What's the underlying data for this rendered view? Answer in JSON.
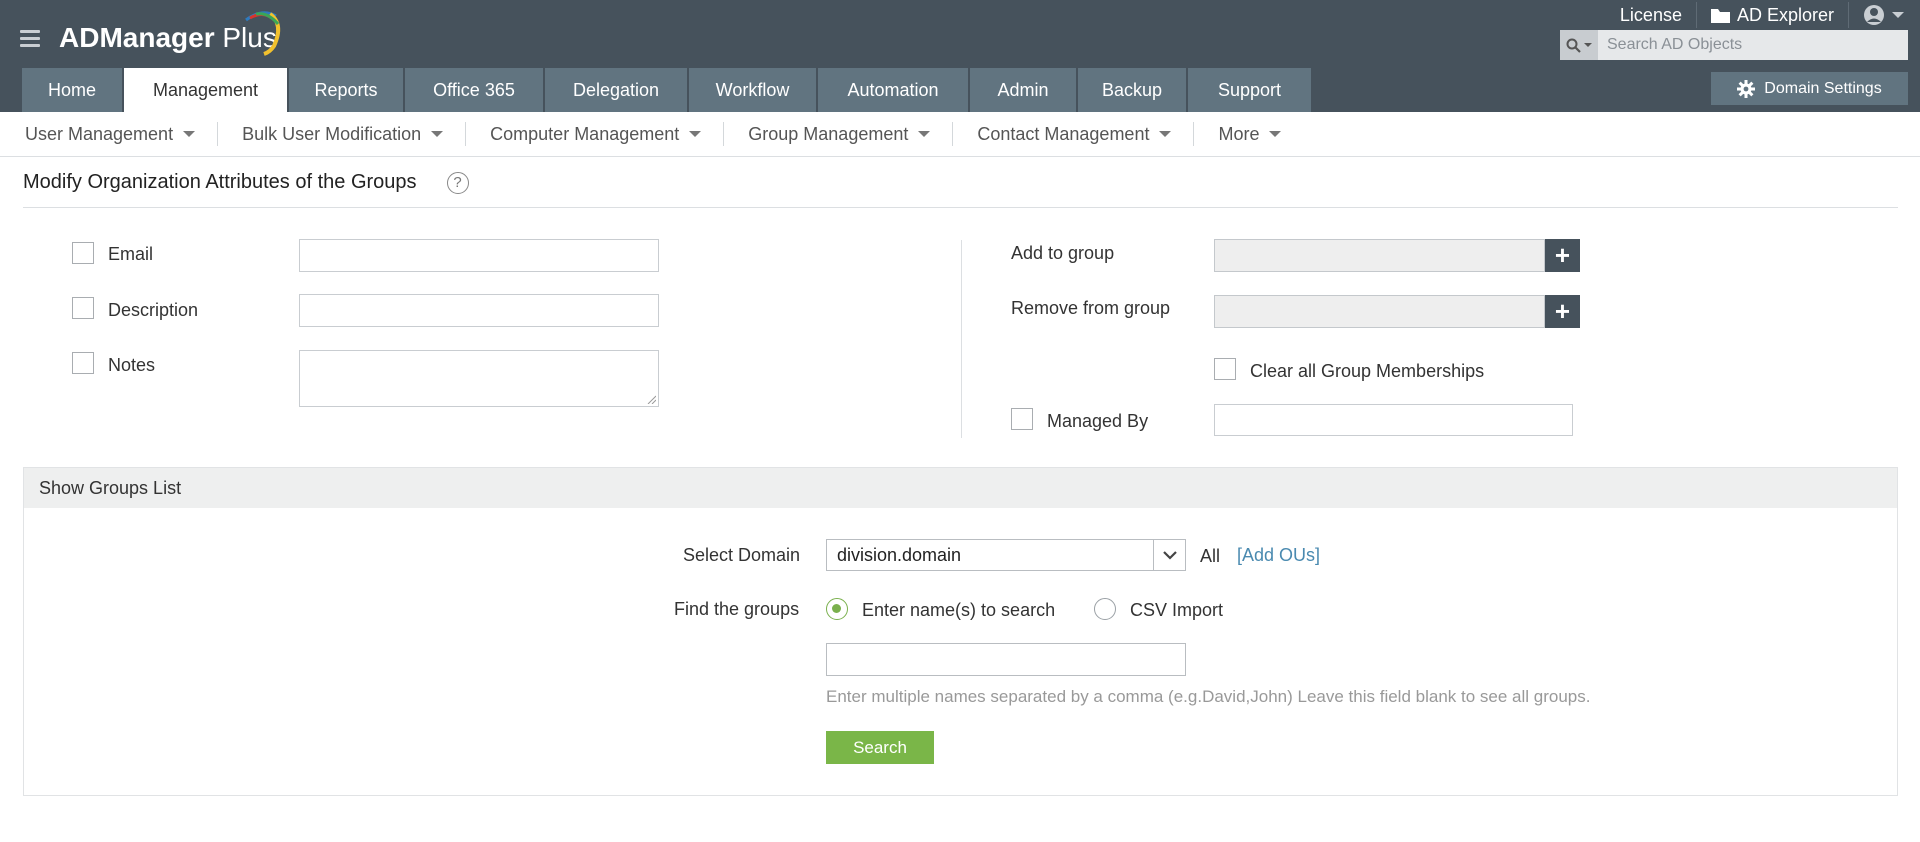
{
  "header": {
    "logo_main": "ADManager",
    "logo_plus": " Plus",
    "top_links": [
      {
        "label": "License",
        "icon": ""
      },
      {
        "label": "AD Explorer",
        "icon": "folder-icon"
      },
      {
        "label": "",
        "icon": "user-account-icon"
      }
    ],
    "search_placeholder": "Search AD Objects",
    "tabs": [
      "Home",
      "Management",
      "Reports",
      "Office 365",
      "Delegation",
      "Workflow",
      "Automation",
      "Admin",
      "Backup",
      "Support"
    ],
    "active_tab": "Management",
    "domain_settings": "Domain Settings"
  },
  "subnav": [
    "User Management",
    "Bulk User Modification",
    "Computer Management",
    "Group Management",
    "Contact Management",
    "More"
  ],
  "page": {
    "title": "Modify Organization Attributes of the Groups",
    "help": "?"
  },
  "form_left": {
    "email": "Email",
    "description": "Description",
    "notes": "Notes"
  },
  "form_right": {
    "add_to_group": "Add to group",
    "remove_from_group": "Remove from group",
    "plus": "+",
    "clear_memberships": "Clear all Group Memberships",
    "managed_by": "Managed By"
  },
  "groups_list": {
    "header": "Show Groups List",
    "select_domain_label": "Select Domain",
    "domain_value": "division.domain",
    "all_label": "All",
    "add_ous": "[Add OUs]",
    "find_groups_label": "Find the groups",
    "option_names": "Enter name(s) to search",
    "option_csv": "CSV Import",
    "selected_option": "names",
    "hint": "Enter multiple names separated by a comma (e.g.David,John) Leave this field blank to see all groups.",
    "search_button": "Search"
  },
  "colors": {
    "header_bg": "#46525c",
    "tab_bg": "#617480",
    "accent_green": "#7ab648",
    "link_blue": "#4a8ab0"
  }
}
